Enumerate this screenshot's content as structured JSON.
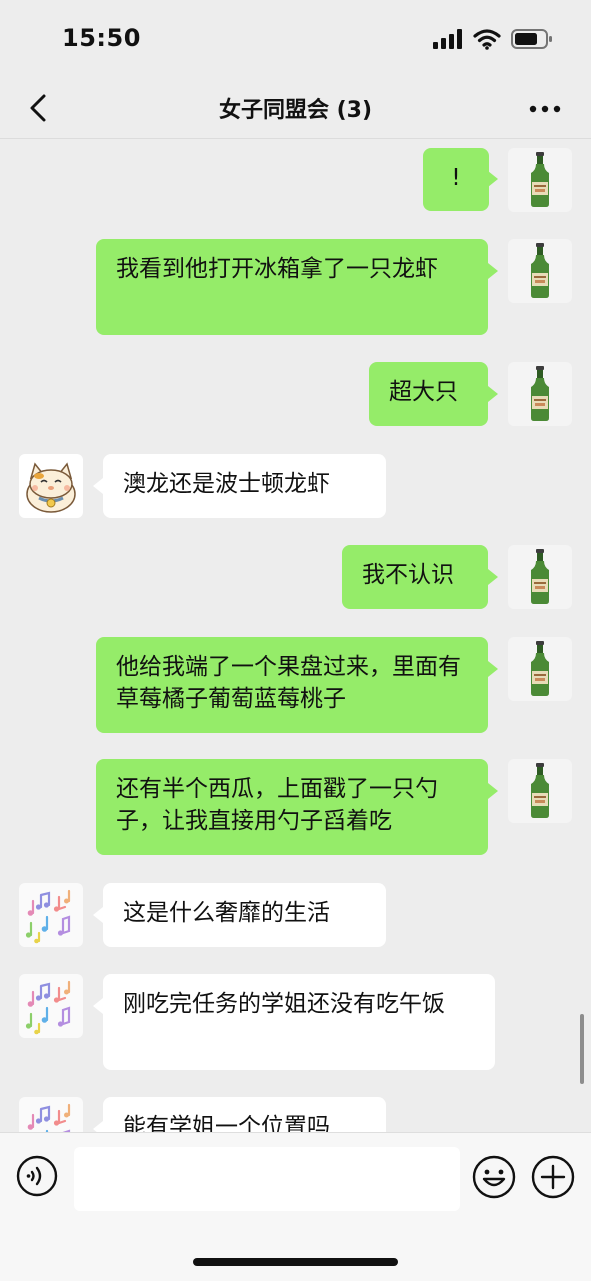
{
  "status_bar": {
    "time": "15:50"
  },
  "header": {
    "title": "女子同盟会 (3)"
  },
  "messages": [
    {
      "side": "me",
      "avatar": "green-bottle-avatar",
      "text": "!"
    },
    {
      "side": "me",
      "avatar": "green-bottle-avatar",
      "text": "我看到他打开冰箱拿了一只龙虾"
    },
    {
      "side": "me",
      "avatar": "green-bottle-avatar",
      "text": "超大只"
    },
    {
      "side": "other",
      "avatar": "lucky-cat-avatar",
      "text": "澳龙还是波士顿龙虾"
    },
    {
      "side": "me",
      "avatar": "green-bottle-avatar",
      "text": "我不认识"
    },
    {
      "side": "me",
      "avatar": "green-bottle-avatar",
      "text": "他给我端了一个果盘过来，里面有草莓橘子葡萄蓝莓桃子"
    },
    {
      "side": "me",
      "avatar": "green-bottle-avatar",
      "text": "还有半个西瓜，上面戳了一只勺子，让我直接用勺子舀着吃"
    },
    {
      "side": "other",
      "avatar": "music-notes-avatar",
      "text": "这是什么奢靡的生活"
    },
    {
      "side": "other",
      "avatar": "music-notes-avatar",
      "text": "刚吃完任务的学姐还没有吃午饭"
    },
    {
      "side": "other",
      "avatar": "music-notes-avatar",
      "text": "能有学姐一个位置吗"
    }
  ],
  "colors": {
    "my_bubble": "#95ec69",
    "other_bubble": "#ffffff",
    "background": "#ededed"
  },
  "input": {
    "value": "",
    "placeholder": ""
  }
}
